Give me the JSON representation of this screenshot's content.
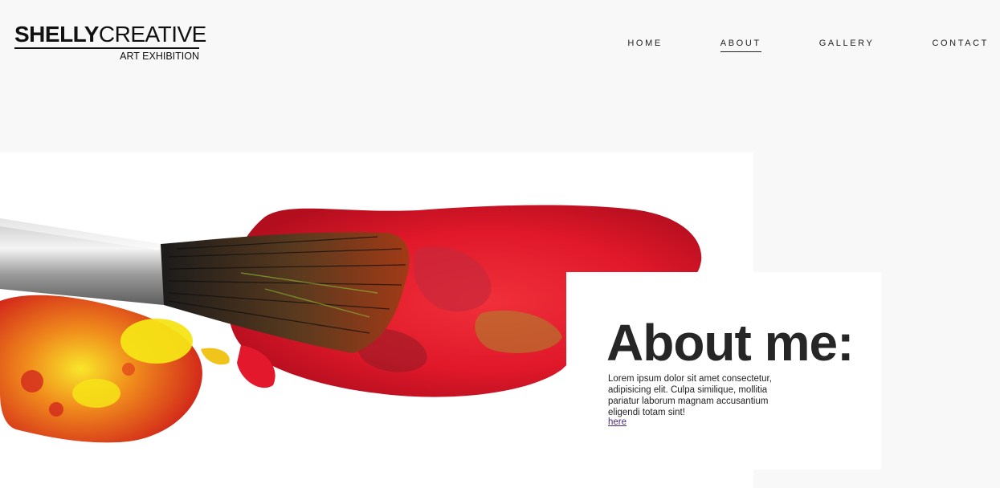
{
  "logo": {
    "name_bold": "SHELLY",
    "name_light": "CREATIVE",
    "subtitle": "ART EXHIBITION"
  },
  "nav": {
    "items": [
      {
        "label": "HOME",
        "active": false
      },
      {
        "label": "ABOUT",
        "active": true
      },
      {
        "label": "GALLERY",
        "active": false
      },
      {
        "label": "CONTACT",
        "active": false
      }
    ]
  },
  "hero": {
    "image": "paintbrush-with-red-paint"
  },
  "about": {
    "title": "About me:",
    "body": "Lorem ipsum dolor sit amet consectetur, adipisicing elit. Culpa similique, mollitia pariatur laborum magnam accusantium eligendi totam sint!",
    "link_label": "here"
  },
  "colors": {
    "background": "#f9f8f9",
    "paint_red": "#e3182c",
    "paint_yellow": "#f6e416",
    "link": "#4b2a7a"
  }
}
